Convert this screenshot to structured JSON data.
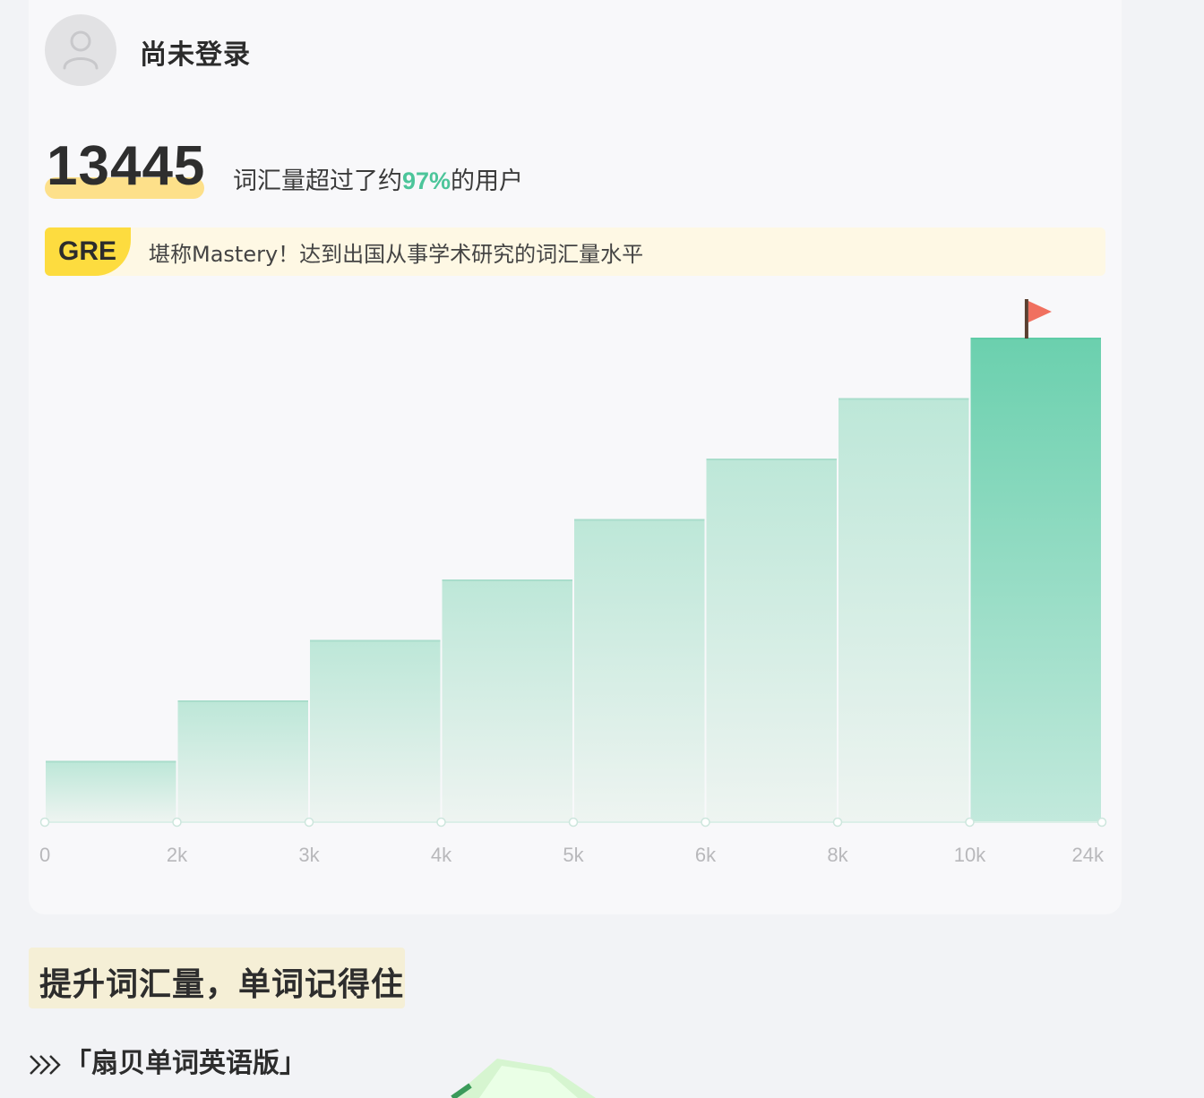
{
  "user": {
    "name": "尚未登录",
    "avatar_icon": "user-icon"
  },
  "stats": {
    "vocab_count": "13445",
    "percentile_prefix": "词汇量超过了约",
    "percentile_value": "97%",
    "percentile_suffix": "的用户"
  },
  "level": {
    "badge": "GRE",
    "description": "堪称Mastery！达到出国从事学术研究的词汇量水平"
  },
  "colors": {
    "accent_green": "#4cc59a",
    "highlight_yellow": "#fddc3f",
    "flag_red": "#f0705f"
  },
  "chart_data": {
    "type": "bar",
    "x_ticks": [
      "0",
      "2k",
      "3k",
      "4k",
      "5k",
      "6k",
      "8k",
      "10k",
      "24k"
    ],
    "bins": [
      "0-2k",
      "2k-3k",
      "3k-4k",
      "4k-5k",
      "5k-6k",
      "6k-8k",
      "8k-10k",
      "10k-24k"
    ],
    "values": [
      1,
      2,
      3,
      4,
      5,
      6,
      7,
      8
    ],
    "highlighted_bin": 7,
    "marker_icon": "flag-icon",
    "title": "",
    "xlabel": "",
    "ylabel": ""
  },
  "promo": {
    "title": "提升词汇量，单词记得住",
    "app_link": "「扇贝单词英语版」",
    "link_icon": "triple-chevron-right-icon"
  }
}
